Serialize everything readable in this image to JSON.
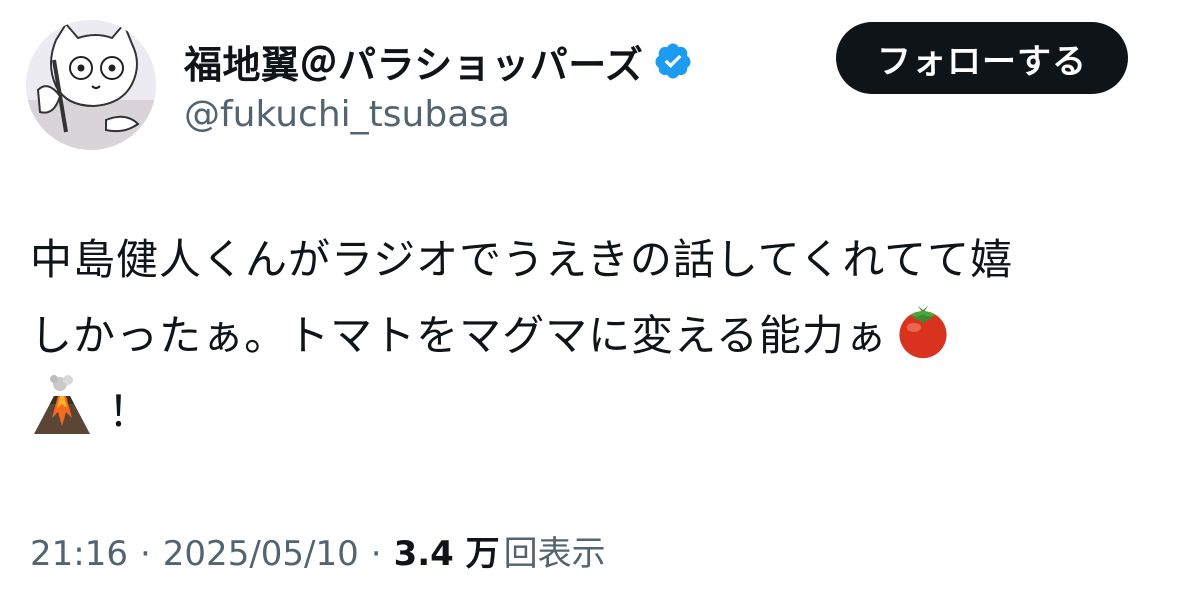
{
  "author": {
    "display_name": "福地翼＠パラショッパーズ",
    "handle": "@fukuchi_tsubasa",
    "verified": true,
    "avatar_icon": "cartoon-cat-avatar"
  },
  "follow_button": {
    "label": "フォローする"
  },
  "tweet": {
    "line1": "中島健人くんがラジオでうえきの話してくれてて嬉",
    "line2": "しかったぁ。トマトをマグマに変える能力ぁ",
    "line3": "！",
    "emoji_tomato": "tomato-emoji",
    "emoji_volcano": "volcano-emoji"
  },
  "meta": {
    "time": "21:16",
    "dot1": "·",
    "date": "2025/05/10",
    "dot2": "·",
    "views_count": "3.4 万",
    "views_label": "回表示"
  },
  "colors": {
    "text_primary": "#0f1419",
    "text_secondary": "#536471",
    "verified_blue": "#1d9bf0",
    "button_bg": "#0f1419"
  }
}
